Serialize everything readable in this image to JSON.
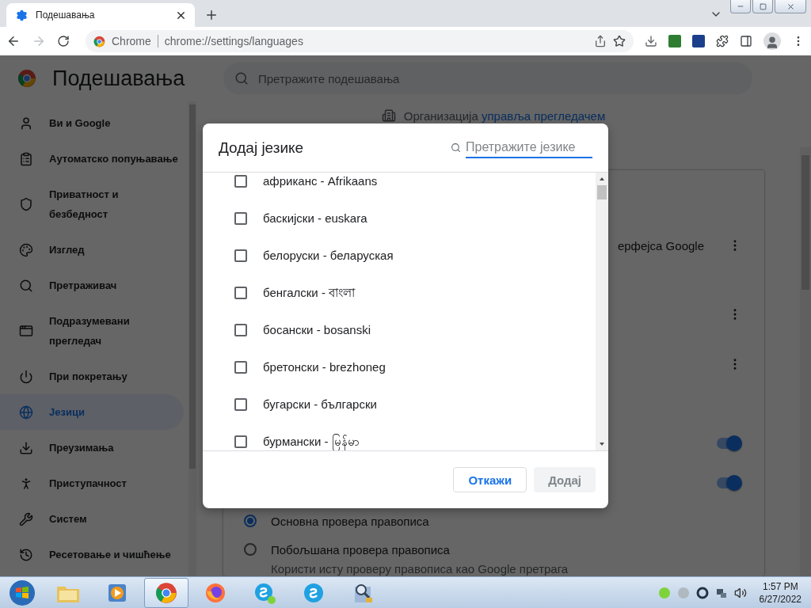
{
  "browser": {
    "tabs": [
      {
        "title": "Подешавања",
        "selected": true
      }
    ],
    "omnibox": {
      "chip": "Chrome",
      "url": "chrome://settings/languages"
    }
  },
  "settings": {
    "title": "Подешавања",
    "search": {
      "placeholder": "Претражите подешавања"
    },
    "sidebar": {
      "items": [
        {
          "label": "Ви и Google",
          "selected": false
        },
        {
          "label": "Аутоматско попуњавање",
          "selected": false
        },
        {
          "label": "Приватност и\nбезбедност",
          "selected": false
        },
        {
          "label": "Изглед",
          "selected": false
        },
        {
          "label": "Претраживач",
          "selected": false
        },
        {
          "label": "Подразумевани\nпрегледач",
          "selected": false
        },
        {
          "label": "При покретању",
          "selected": false
        },
        {
          "label": "Језици",
          "selected": true
        },
        {
          "label": "Преузимања",
          "selected": false
        },
        {
          "label": "Приступачност",
          "selected": false
        },
        {
          "label": "Систем",
          "selected": false
        },
        {
          "label": "Ресетовање и чишћење",
          "selected": false
        }
      ]
    },
    "managed_notice": {
      "prefix": "Организација",
      "link": "управља прегледачем"
    },
    "partial_text": "ерфејса Google",
    "toggles": [
      {
        "on": true
      },
      {
        "on": true
      }
    ],
    "spellcheck_options": [
      {
        "label": "Основна провера правописа",
        "selected": true
      },
      {
        "label": "Побољшана провера правописа",
        "selected": false
      }
    ],
    "spellcheck_hint": "Користи исту проверу правописа као Google претрага"
  },
  "dialog": {
    "title": "Додај језике",
    "search": {
      "placeholder": "Претражите језике"
    },
    "languages": [
      {
        "label": "африканс - Afrikaans",
        "checked": false
      },
      {
        "label": "баскијски - euskara",
        "checked": false
      },
      {
        "label": "белоруски - беларуская",
        "checked": false
      },
      {
        "label": "бенгалски - বাংলা",
        "checked": false
      },
      {
        "label": "босански - bosanski",
        "checked": false
      },
      {
        "label": "бретонски - brezhoneg",
        "checked": false
      },
      {
        "label": "бугарски - български",
        "checked": false
      },
      {
        "label": "бурмански - မြန်မာ",
        "checked": false
      }
    ],
    "buttons": [
      {
        "label": "Откажи",
        "kind": "secondary",
        "disabled": false
      },
      {
        "label": "Додај",
        "kind": "primary",
        "disabled": true
      }
    ]
  },
  "taskbar": {
    "apps": [
      {
        "kind": "explorer",
        "active": false
      },
      {
        "kind": "media",
        "active": false
      },
      {
        "kind": "chrome",
        "active": true
      },
      {
        "kind": "firefox",
        "active": false
      },
      {
        "kind": "skypebiz",
        "active": false
      },
      {
        "kind": "skype",
        "active": false
      },
      {
        "kind": "tool",
        "active": false
      }
    ],
    "clock": {
      "time": "1:57 PM",
      "date": "6/27/2022"
    }
  }
}
